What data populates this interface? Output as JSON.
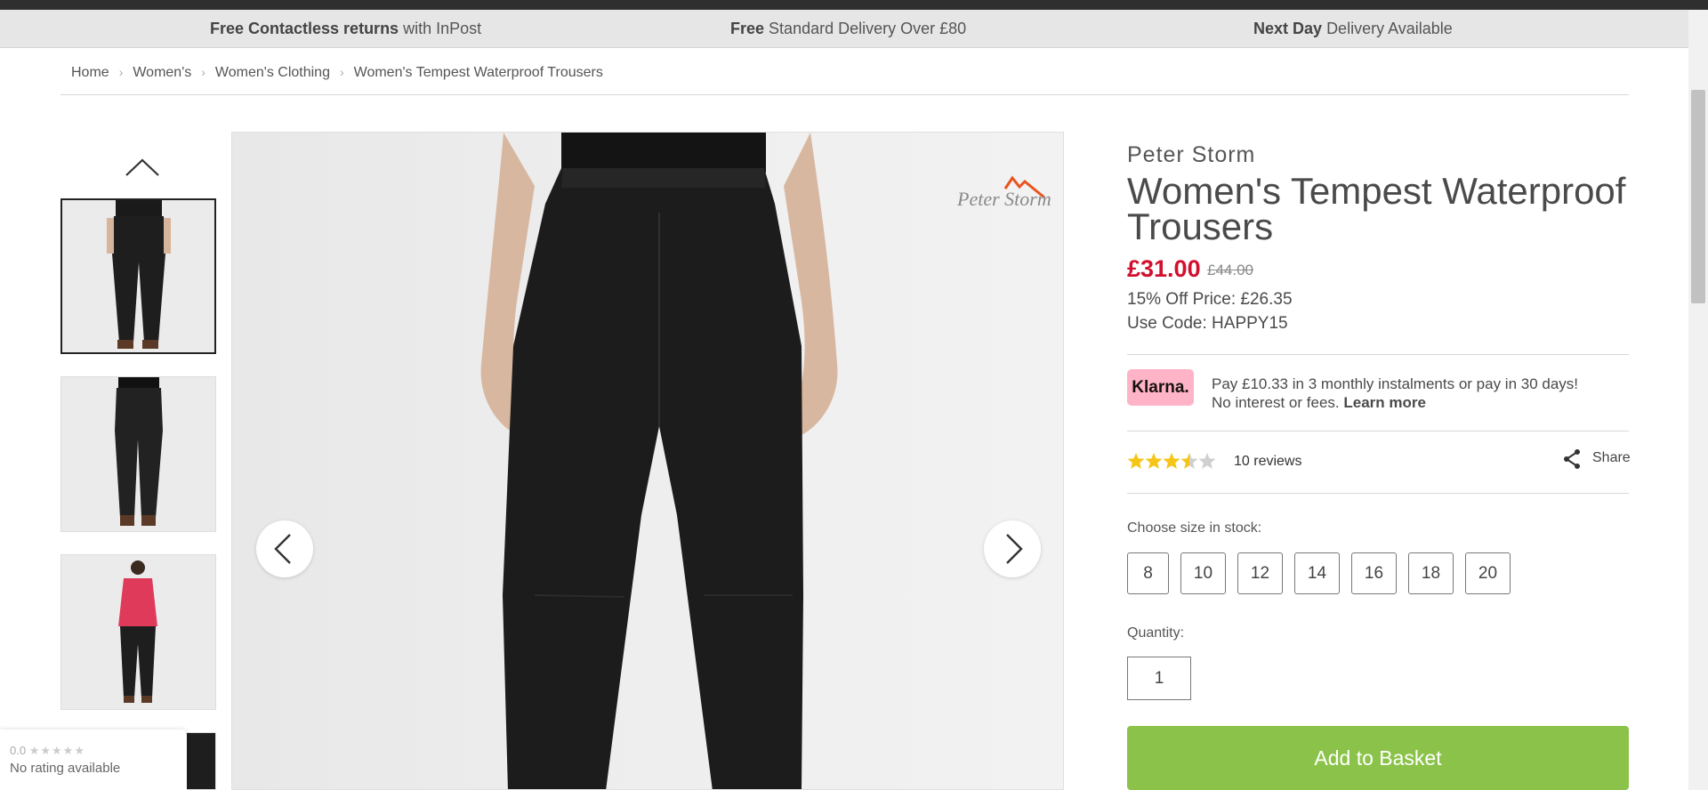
{
  "promo": {
    "item1_bold": "Free Contactless returns",
    "item1_rest": "with InPost",
    "item2_bold": "Free",
    "item2_rest": "Standard Delivery Over £80",
    "item3_bold": "Next Day",
    "item3_rest": "Delivery Available"
  },
  "breadcrumb": [
    "Home",
    "Women's",
    "Women's Clothing",
    "Women's Tempest Waterproof Trousers"
  ],
  "product": {
    "brand": "Peter Storm",
    "title": "Women's Tempest Waterproof Trousers",
    "price": "£31.00",
    "was_price": "£44.00",
    "offer_line": "15% Off Price: £26.35",
    "code_line": "Use Code: HAPPY15",
    "image_logo": "Peter Storm"
  },
  "klarna": {
    "badge": "Klarna.",
    "line1": "Pay £10.33 in 3 monthly instalments or pay in 30 days!",
    "line2": "No interest or fees.",
    "link": "Learn more"
  },
  "rating": {
    "stars": 3.5,
    "max": 5,
    "reviews_label": "10 reviews",
    "share_label": "Share"
  },
  "size": {
    "label": "Choose size in stock:",
    "options": [
      "8",
      "10",
      "12",
      "14",
      "16",
      "18",
      "20"
    ]
  },
  "quantity": {
    "label": "Quantity:",
    "value": "1"
  },
  "add_to_basket": "Add to Basket",
  "rating_widget": {
    "score": "0.0",
    "text": "No rating available"
  },
  "colors": {
    "price_red": "#d2102e",
    "add_green": "#8bc34a",
    "klarna_pink": "#ffb3c7",
    "star_gold": "#f5c518"
  }
}
